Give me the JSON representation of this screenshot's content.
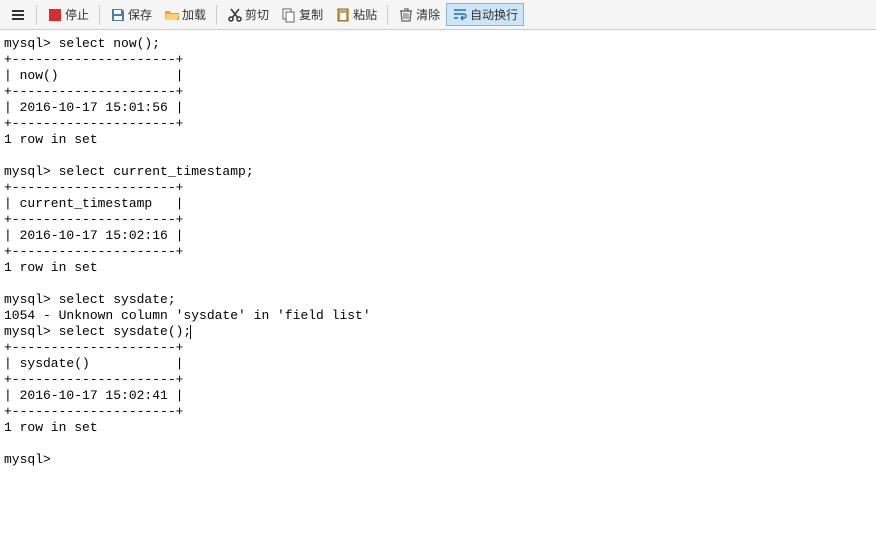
{
  "toolbar": {
    "menu": "",
    "stop": "停止",
    "save": "保存",
    "load": "加载",
    "cut": "剪切",
    "copy": "复制",
    "paste": "粘贴",
    "clear": "清除",
    "wrap": "自动换行"
  },
  "console": {
    "lines": [
      "mysql> select now();",
      "+---------------------+",
      "| now()               |",
      "+---------------------+",
      "| 2016-10-17 15:01:56 |",
      "+---------------------+",
      "1 row in set",
      "",
      "mysql> select current_timestamp;",
      "+---------------------+",
      "| current_timestamp   |",
      "+---------------------+",
      "| 2016-10-17 15:02:16 |",
      "+---------------------+",
      "1 row in set",
      "",
      "mysql> select sysdate;",
      "1054 - Unknown column 'sysdate' in 'field list'",
      "mysql> select sysdate();",
      "+---------------------+",
      "| sysdate()           |",
      "+---------------------+",
      "| 2016-10-17 15:02:41 |",
      "+---------------------+",
      "1 row in set",
      "",
      "mysql> "
    ]
  }
}
